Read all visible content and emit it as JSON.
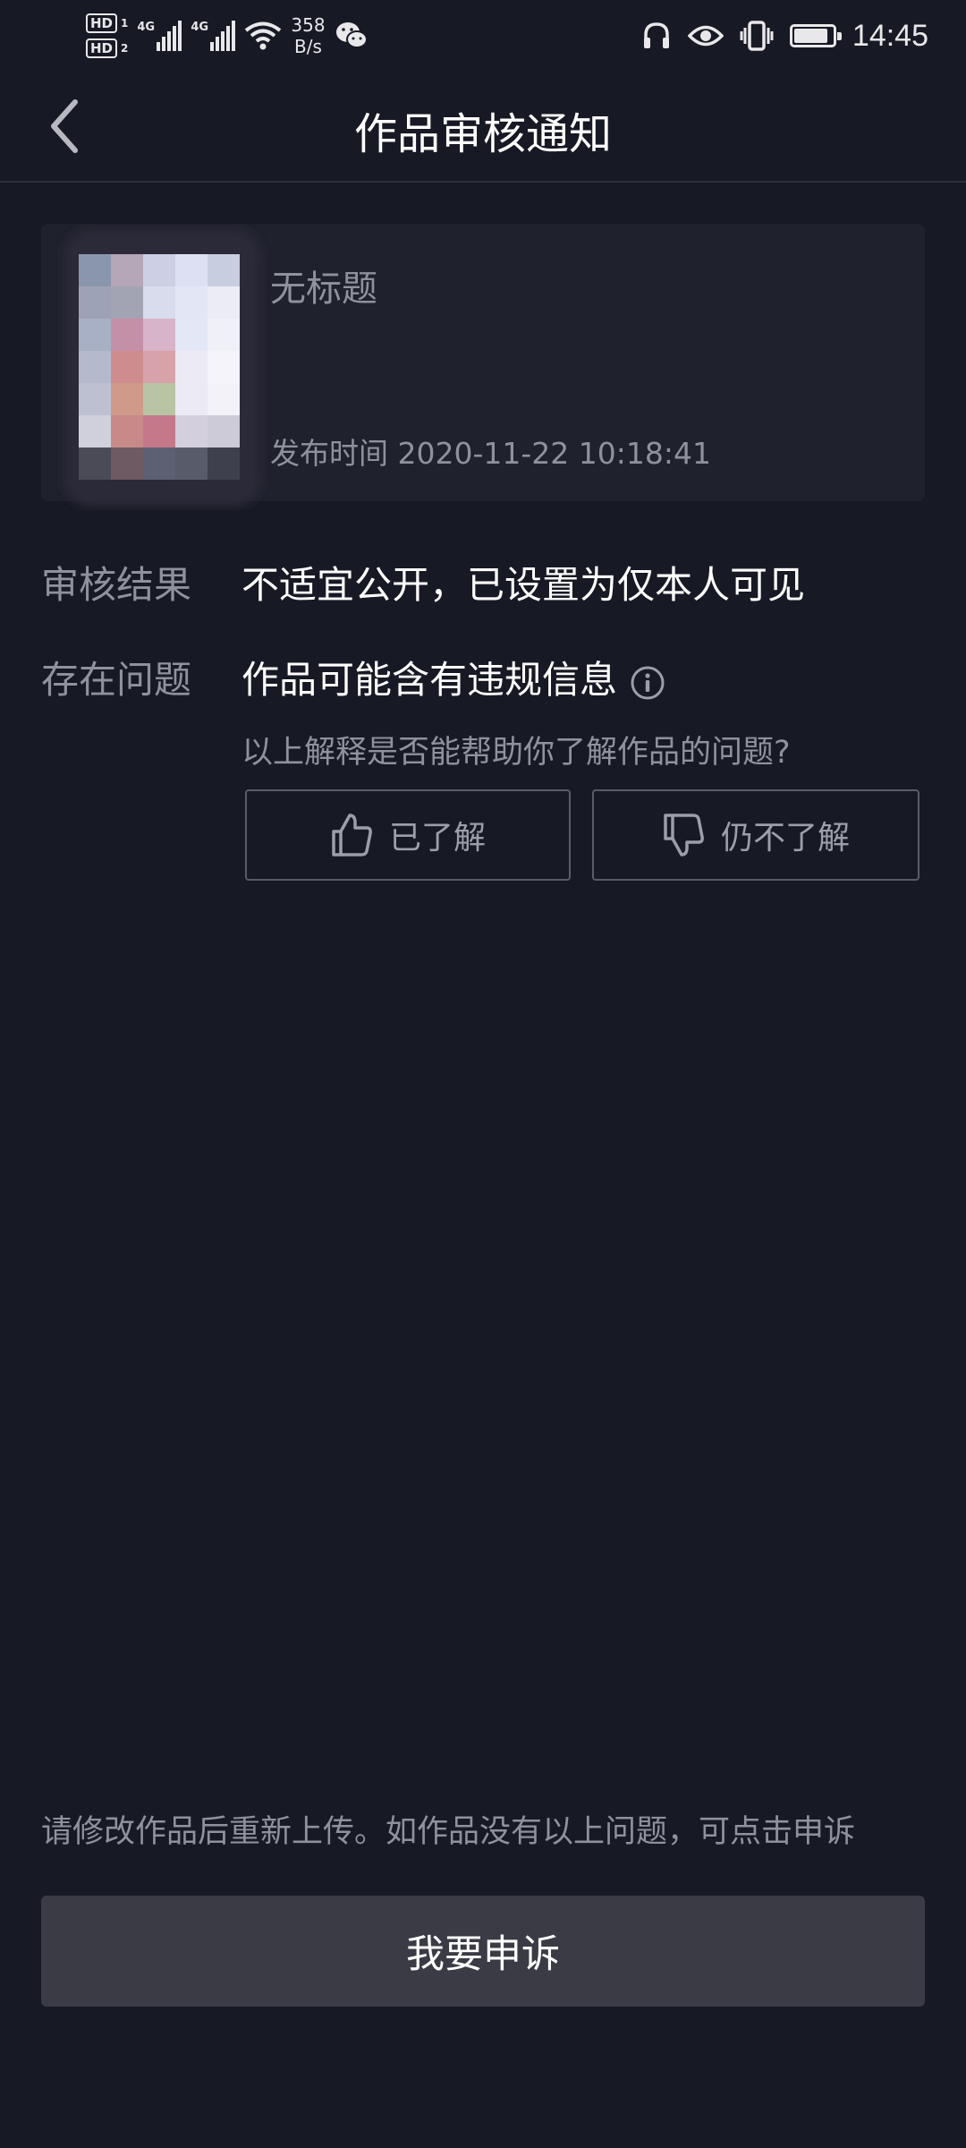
{
  "status_bar": {
    "hd1": "HD",
    "hd1_sub": "1",
    "hd2": "HD",
    "hd2_sub": "2",
    "net1": "4G",
    "net2": "4G",
    "speed_value": "358",
    "speed_unit": "B/s",
    "time": "14:45",
    "battery_level": 0.9,
    "icons": [
      "signal-icon",
      "wifi-icon",
      "wechat-icon",
      "headphones-icon",
      "eye-icon",
      "vibrate-icon",
      "battery-icon"
    ]
  },
  "nav": {
    "title": "作品审核通知",
    "back_icon": "chevron-left-icon"
  },
  "work": {
    "title": "无标题",
    "publish_time": "发布时间 2020-11-22 10:18:41"
  },
  "review": {
    "result_label": "审核结果",
    "result_value": "不适宜公开，已设置为仅本人可见",
    "issue_label": "存在问题",
    "issue_value": "作品可能含有违规信息",
    "feedback_question": "以上解释是否能帮助你了解作品的问题?",
    "understood_label": "已了解",
    "not_understood_label": "仍不了解"
  },
  "footer": {
    "tip": "请修改作品后重新上传。如作品没有以上问题，可点击申诉",
    "appeal_label": "我要申诉"
  },
  "colors": {
    "background": "#171924",
    "card": "#1f212c",
    "muted_text": "#8f919c",
    "appeal_button": "#3a3b45"
  }
}
